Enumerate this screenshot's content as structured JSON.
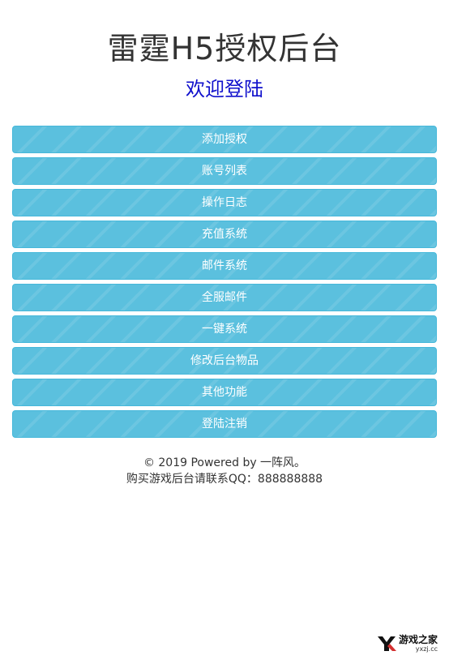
{
  "header": {
    "title": "雷霆H5授权后台",
    "subtitle": "欢迎登陆"
  },
  "menu": {
    "items": [
      {
        "label": "添加授权"
      },
      {
        "label": "账号列表"
      },
      {
        "label": "操作日志"
      },
      {
        "label": "充值系统"
      },
      {
        "label": "邮件系统"
      },
      {
        "label": "全服邮件"
      },
      {
        "label": "一键系统"
      },
      {
        "label": "修改后台物品"
      },
      {
        "label": "其他功能"
      },
      {
        "label": "登陆注销"
      }
    ]
  },
  "footer": {
    "copyright": "© 2019 Powered by 一阵风。",
    "contact": "购买游戏后台请联系QQ：888888888"
  },
  "watermark": {
    "name": "游戏之家",
    "url": "yxzj.cc"
  },
  "colors": {
    "button_bg": "#5bc0de",
    "button_border": "#46b8da",
    "subtitle": "#1010cc",
    "title": "#333333"
  }
}
